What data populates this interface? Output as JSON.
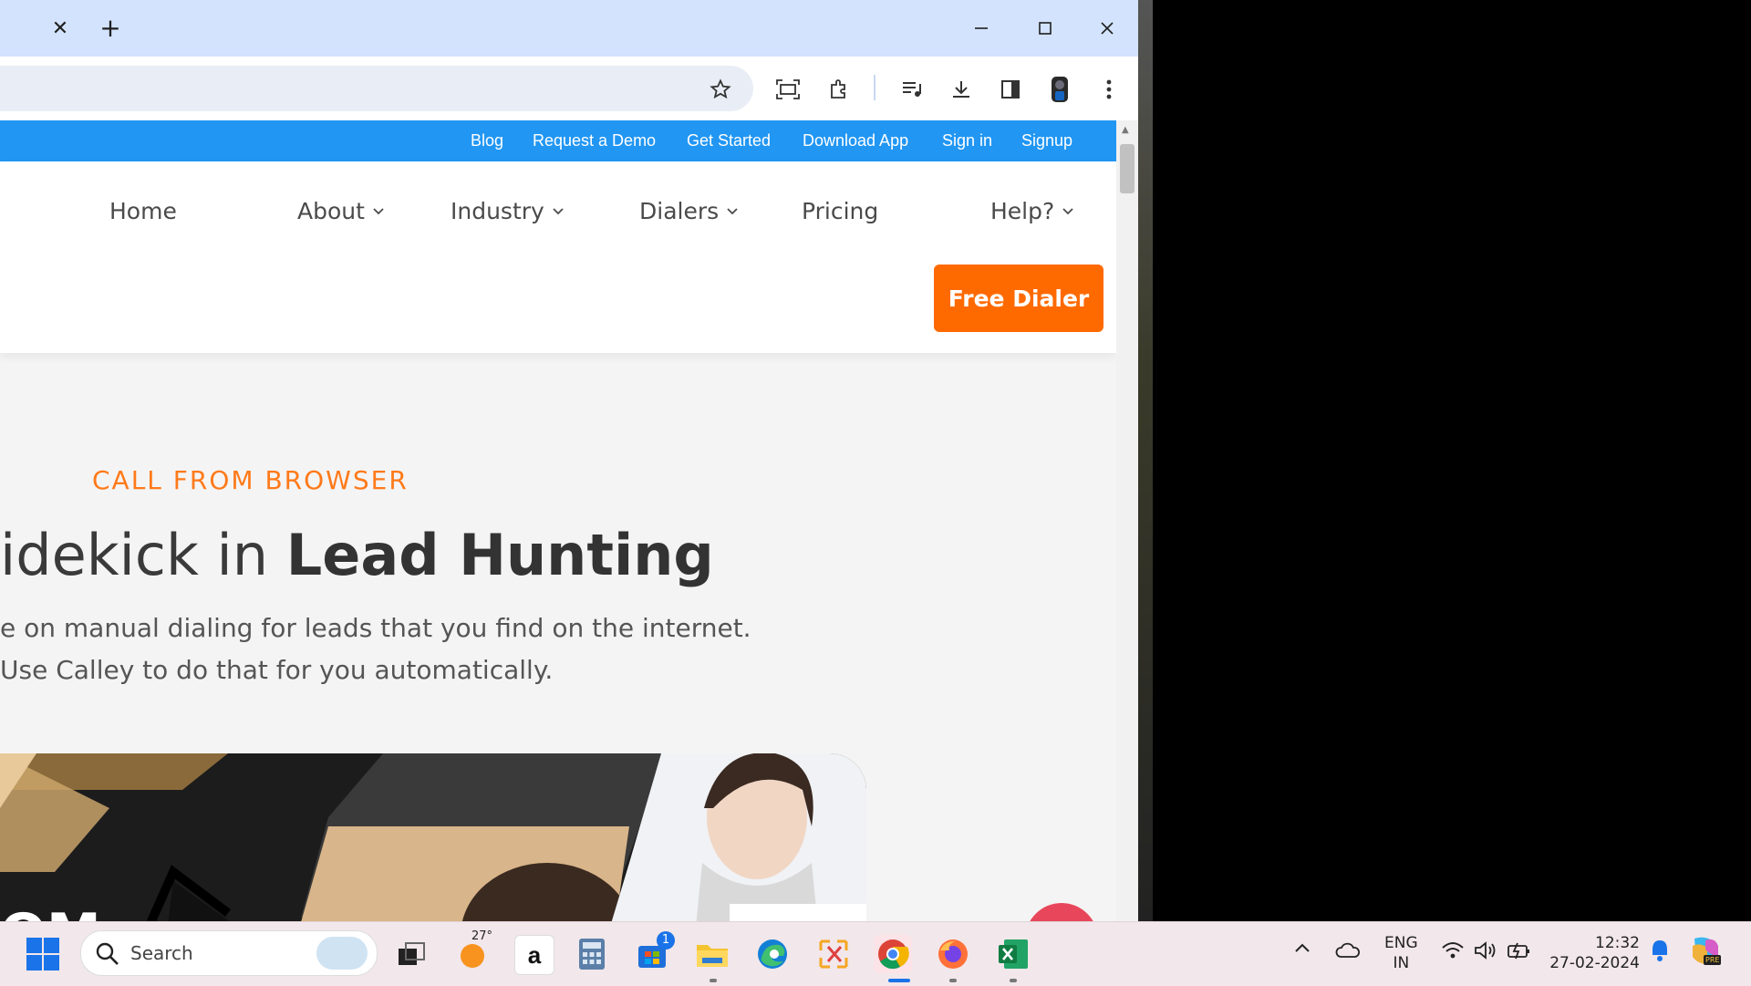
{
  "browser": {
    "tab_close": "✕",
    "new_tab": "+",
    "window": {
      "minimize": "–",
      "maximize": "☐",
      "close": "✕"
    },
    "toolbar_icons": [
      "star-icon",
      "screenshot-icon",
      "extensions-icon",
      "media-icon",
      "download-icon",
      "sidepanel-icon",
      "profile-icon",
      "menu-icon"
    ]
  },
  "top_links": [
    "Blog",
    "Request a Demo",
    "Get Started",
    "Download App",
    "Sign in",
    "Signup"
  ],
  "nav": {
    "items": [
      {
        "label": "Home"
      },
      {
        "label": "About"
      },
      {
        "label": "Industry"
      },
      {
        "label": "Dialers"
      },
      {
        "label": "Pricing"
      },
      {
        "label": "Help?"
      }
    ],
    "cta": "Free Dialer"
  },
  "hero": {
    "eyebrow": "CALL FROM BROWSER",
    "headline_plain": "idekick in ",
    "headline_bold": "Lead Hunting",
    "line1": "e on manual dialing for leads that you find on the internet.",
    "line2": "Use Calley to do that for you automatically.",
    "image_partial_text": "OM"
  },
  "taskbar": {
    "search_placeholder": "Search",
    "weather_temp": "27°",
    "store_badge": "1",
    "lang_primary": "ENG",
    "lang_secondary": "IN",
    "time": "12:32",
    "date": "27-02-2024",
    "copilot_badge": "PRE"
  },
  "colors": {
    "topbar": "#2196f3",
    "accent_orange": "#ff6a00",
    "tabstrip": "#d3e3fd"
  }
}
